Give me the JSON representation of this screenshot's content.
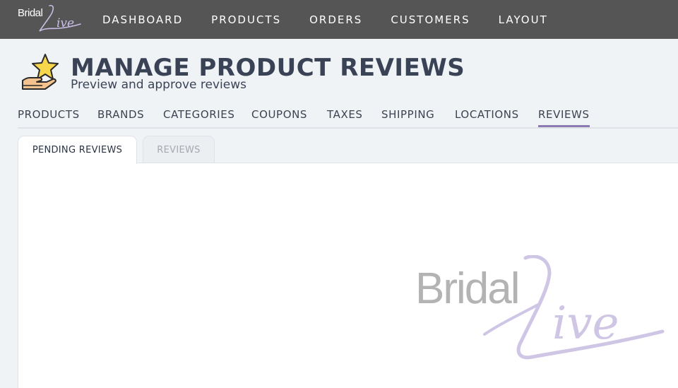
{
  "brand": {
    "logo_text": "Bridal",
    "logo_script": "Live"
  },
  "nav": {
    "items": [
      {
        "label": "DASHBOARD"
      },
      {
        "label": "PRODUCTS"
      },
      {
        "label": "ORDERS"
      },
      {
        "label": "CUSTOMERS"
      },
      {
        "label": "LAYOUT"
      }
    ]
  },
  "header": {
    "icon": "star-in-hand-icon",
    "title": "MANAGE PRODUCT REVIEWS",
    "subtitle": "Preview and approve reviews"
  },
  "section_tabs": [
    {
      "label": "PRODUCTS"
    },
    {
      "label": "BRANDS"
    },
    {
      "label": "CATEGORIES"
    },
    {
      "label": "COUPONS"
    },
    {
      "label": "TAXES"
    },
    {
      "label": "SHIPPING"
    },
    {
      "label": "LOCATIONS"
    },
    {
      "label": "REVIEWS",
      "active": true
    }
  ],
  "subtabs": [
    {
      "label": "PENDING REVIEWS",
      "active": true
    },
    {
      "label": "REVIEWS",
      "active": false
    }
  ],
  "watermark": {
    "text": "Bridal",
    "script": "Live"
  },
  "colors": {
    "topbar": "#555555",
    "accent": "#8c7bb3",
    "background": "#f0f3f6"
  }
}
